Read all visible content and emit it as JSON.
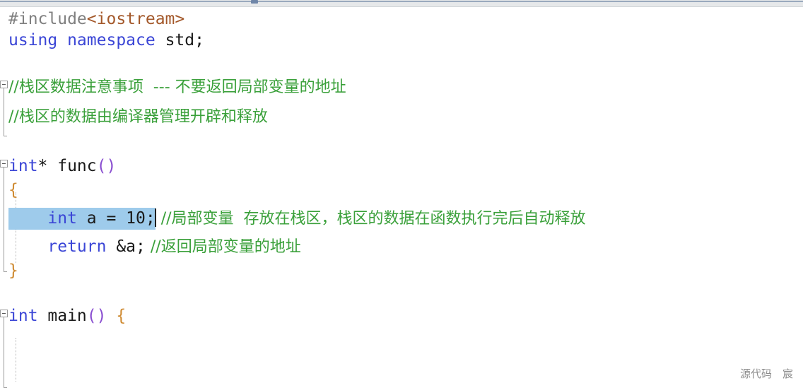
{
  "window": {
    "type": "code-editor",
    "language": "C++",
    "background": "#ffffff"
  },
  "top_bar": {
    "name": "horizontal-scrollbar",
    "track_color": "#e6e8ea",
    "thumb_color": "#6f86a8"
  },
  "colors": {
    "keyword": "#3b46d6",
    "comment": "#3aa03a",
    "preprocessor": "#808080",
    "header": "#a3582a",
    "paren": "#8a4fd0",
    "brace": "#cf8b33",
    "plain": "#1a1a1a",
    "selection": "#9ecbeb",
    "caret": "#202020",
    "gutter_line": "#9a9a9a",
    "indent_guide": "#b9b9b9",
    "watermark": "#8c8c8c"
  },
  "code": {
    "lines": [
      {
        "index": 0,
        "fold": "none",
        "tokens": [
          {
            "text": "#include",
            "kind": "preprocessor"
          },
          {
            "text": "<iostream>",
            "kind": "header"
          }
        ]
      },
      {
        "index": 1,
        "fold": "none",
        "tokens": [
          {
            "text": "using namespace",
            "kind": "keyword"
          },
          {
            "text": " std;",
            "kind": "plain"
          }
        ]
      },
      {
        "index": 2,
        "fold": "none",
        "tokens": []
      },
      {
        "index": 3,
        "fold": "open",
        "tokens": [
          {
            "text": "//栈区数据注意事项  --- 不要返回局部变量的地址",
            "kind": "comment"
          }
        ]
      },
      {
        "index": 4,
        "fold": "body",
        "tokens": [
          {
            "text": "//栈区的数据由编译器管理开辟和释放",
            "kind": "comment"
          }
        ]
      },
      {
        "index": 5,
        "fold": "none",
        "tokens": []
      },
      {
        "index": 6,
        "fold": "open",
        "tokens": [
          {
            "text": "int",
            "kind": "keyword"
          },
          {
            "text": "* func",
            "kind": "plain"
          },
          {
            "text": "()",
            "kind": "paren"
          }
        ]
      },
      {
        "index": 7,
        "fold": "body",
        "tokens": [
          {
            "text": "{",
            "kind": "brace"
          }
        ]
      },
      {
        "index": 8,
        "fold": "body",
        "selected": true,
        "selection_text": "int a = 10;",
        "tokens": [
          {
            "text": "int",
            "kind": "keyword"
          },
          {
            "text": " a = 10;",
            "kind": "plain"
          },
          {
            "text": " //局部变量  存放在栈区，栈区的数据在函数执行完后自动释放",
            "kind": "comment"
          }
        ]
      },
      {
        "index": 9,
        "fold": "body",
        "tokens": [
          {
            "text": "return",
            "kind": "keyword"
          },
          {
            "text": " &a;",
            "kind": "plain"
          },
          {
            "text": " //返回局部变量的地址",
            "kind": "comment"
          }
        ]
      },
      {
        "index": 10,
        "fold": "body-end",
        "tokens": [
          {
            "text": "}",
            "kind": "brace"
          }
        ]
      },
      {
        "index": 11,
        "fold": "none",
        "tokens": []
      },
      {
        "index": 12,
        "fold": "open",
        "tokens": [
          {
            "text": "int",
            "kind": "keyword"
          },
          {
            "text": " main",
            "kind": "plain"
          },
          {
            "text": "()",
            "kind": "paren"
          },
          {
            "text": " {",
            "kind": "brace"
          }
        ]
      },
      {
        "index": 13,
        "fold": "body",
        "tokens": []
      },
      {
        "index": 14,
        "fold": "body",
        "tokens": []
      }
    ]
  },
  "line_text": {
    "l0_include": "#include",
    "l0_header": "<iostream>",
    "l1_kw": "using namespace",
    "l1_rest": " std;",
    "l3_comment": "//栈区数据注意事项  --- 不要返回局部变量的地址",
    "l4_comment": "//栈区的数据由编译器管理开辟和释放",
    "l6_kw": "int",
    "l6_name": "* func",
    "l6_paren": "()",
    "l7_brace": "{",
    "l8_kw": "int",
    "l8_rest": " a = 10;",
    "l8_comment": "//局部变量  存放在栈区，栈区的数据在函数执行完后自动释放",
    "l9_kw": "return",
    "l9_rest": " &a;",
    "l9_comment": "//返回局部变量的地址",
    "l10_brace": "}",
    "l12_kw": "int",
    "l12_name": " main",
    "l12_paren": "()",
    "l12_brace": " {"
  },
  "watermark": {
    "text": "源代码　宸"
  }
}
